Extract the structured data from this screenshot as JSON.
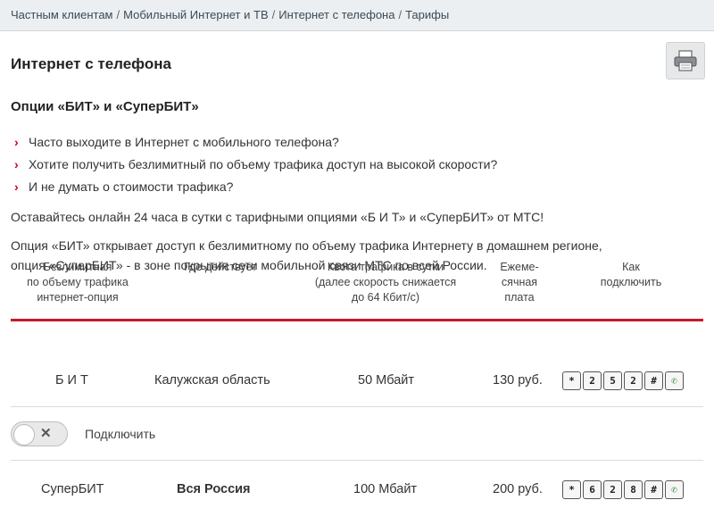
{
  "breadcrumb": {
    "items": [
      "Частным клиентам",
      "Мобильный Интернет и ТВ",
      "Интернет с телефона",
      "Тарифы"
    ],
    "separator": "/"
  },
  "page": {
    "title": "Интернет с телефона",
    "print_icon": "printer-icon"
  },
  "section": {
    "title": "Опции «БИТ» и «СуперБИТ»",
    "bullets": [
      "Часто выходите в Интернет с мобильного телефона?",
      "Хотите получить безлимитный по объему трафика доступ на высокой скорости?",
      "И не думать о стоимости трафика?"
    ],
    "paragraph1": "Оставайтесь онлайн 24 часа в сутки с тарифными опциями «Б И Т» и «СуперБИТ» от МТС!",
    "paragraph2_line1": "Опция «БИТ» открывает доступ к безлимитному по объему трафика Интернету в домашнем регионе,",
    "paragraph2_line2": "опция «СуперБИТ» - в зоне покрытия сети мобильной связи МТС по всей России."
  },
  "table": {
    "headers": {
      "option": [
        "Безлимитная",
        "по объему трафика",
        "интернет-опция"
      ],
      "where": [
        "Где действует"
      ],
      "quota": [
        "Квота  трафика в сутки",
        "(далее скорость снижается",
        "до 64 Кбит/с)"
      ],
      "fee": [
        "Ежеме-",
        "сячная",
        "плата"
      ],
      "how": [
        "Как",
        "подключить"
      ]
    },
    "rows": [
      {
        "option": "Б И Т",
        "where": "Калужская область",
        "quota": "50 Мбайт",
        "fee": "130 руб.",
        "keys": [
          "*",
          "2",
          "5",
          "2",
          "#",
          "✆"
        ]
      },
      {
        "option": "СуперБИТ",
        "where": "Вся Россия",
        "quota": "100 Мбайт",
        "fee": "200 руб.",
        "keys": [
          "*",
          "6",
          "2",
          "8",
          "#",
          "✆"
        ]
      }
    ],
    "accent_color": "#c6192b"
  },
  "toggle": {
    "label": "Подключить",
    "state": "off",
    "off_glyph": "✕"
  }
}
